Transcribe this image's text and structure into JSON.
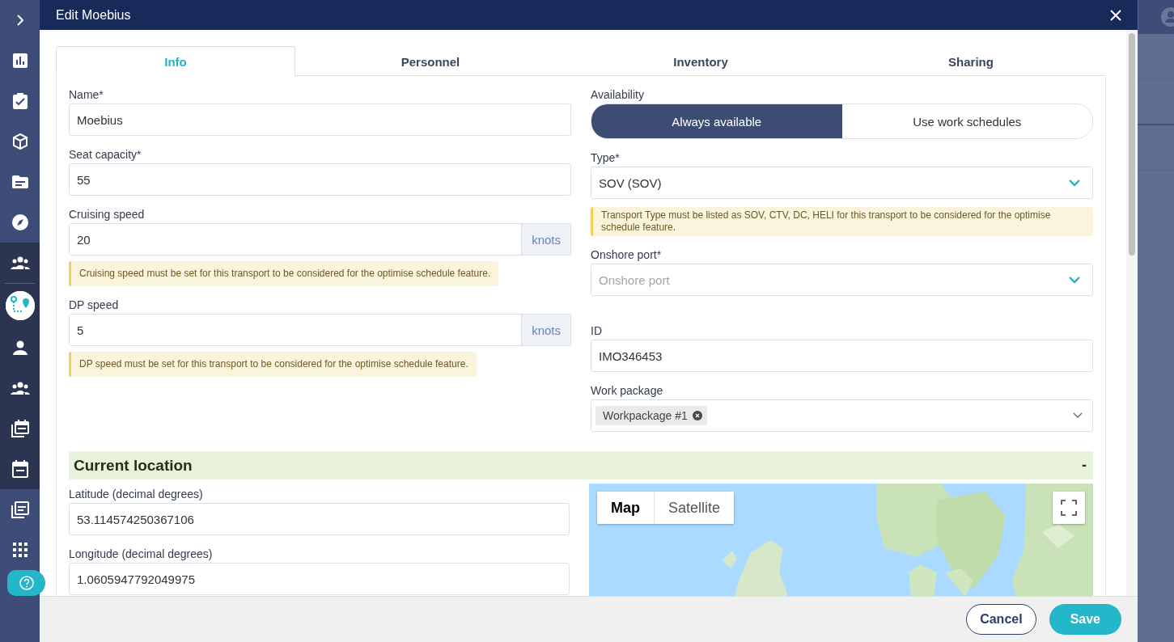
{
  "sidebar": {
    "groups": [
      {
        "dark": false,
        "items": [
          {
            "kind": "expand",
            "selected": false
          },
          {
            "kind": "chart",
            "selected": false
          },
          {
            "kind": "clipboard",
            "selected": false
          },
          {
            "kind": "cube",
            "selected": false
          },
          {
            "kind": "folder",
            "selected": false
          },
          {
            "kind": "compass",
            "selected": false
          }
        ]
      },
      {
        "dark": true,
        "items": [
          {
            "kind": "team",
            "selected": false
          },
          {
            "kind": "route",
            "selected": true
          },
          {
            "kind": "person",
            "selected": false
          },
          {
            "kind": "team",
            "selected": false
          },
          {
            "kind": "calendar-stack",
            "selected": false
          },
          {
            "kind": "calendar",
            "selected": false
          }
        ]
      },
      {
        "dark": false,
        "items": [
          {
            "kind": "notes",
            "selected": false
          },
          {
            "kind": "grid",
            "selected": false
          }
        ]
      }
    ],
    "help": {
      "kind": "help"
    }
  },
  "dialog": {
    "title": "Edit Moebius",
    "tabs": [
      {
        "label": "Info",
        "selected": true
      },
      {
        "label": "Personnel",
        "selected": false
      },
      {
        "label": "Inventory",
        "selected": false
      },
      {
        "label": "Sharing",
        "selected": false
      }
    ],
    "left_fields": [
      {
        "label": "Name*",
        "value": "Moebius"
      },
      {
        "label": "Seat capacity*",
        "value": "55"
      },
      {
        "label": "Cruising speed",
        "value": "20",
        "unit": "knots",
        "note": "Cruising speed must be set for this transport to be considered for the optimise schedule feature."
      },
      {
        "label": "DP speed",
        "value": "5",
        "unit": "knots",
        "note": "DP speed must be set for this transport to be considered for the optimise schedule feature."
      }
    ],
    "availability": {
      "label": "Availability",
      "options": [
        {
          "label": "Always available",
          "selected": true
        },
        {
          "label": "Use work schedules",
          "selected": false
        }
      ]
    },
    "right_fields": [
      {
        "kind": "select",
        "label": "Type*",
        "value": "SOV (SOV)",
        "note": "Transport Type must be listed as SOV, CTV, DC, HELI for this transport to be considered for the optimise schedule feature."
      },
      {
        "kind": "select",
        "label": "Onshore port*",
        "placeholder": "Onshore port"
      },
      {
        "kind": "text",
        "label": "ID",
        "value": "IMO346453"
      },
      {
        "kind": "tags",
        "label": "Work package",
        "tags": [
          "Workpackage #1"
        ]
      }
    ],
    "location": {
      "title": "Current location",
      "toggle": "-",
      "expanded": true,
      "fields": [
        {
          "label": "Latitude (decimal degrees)",
          "value": "53.114574250367106"
        },
        {
          "label": "Longitude (decimal degrees)",
          "value": "1.0605947792049975"
        }
      ],
      "map": {
        "kind": "picture",
        "map_types": [
          {
            "label": "Map",
            "selected": true
          },
          {
            "label": "Satellite",
            "selected": false
          }
        ]
      }
    },
    "buttons": [
      {
        "label": "Cancel",
        "kind": "secondary"
      },
      {
        "label": "Save",
        "kind": "primary"
      }
    ]
  }
}
